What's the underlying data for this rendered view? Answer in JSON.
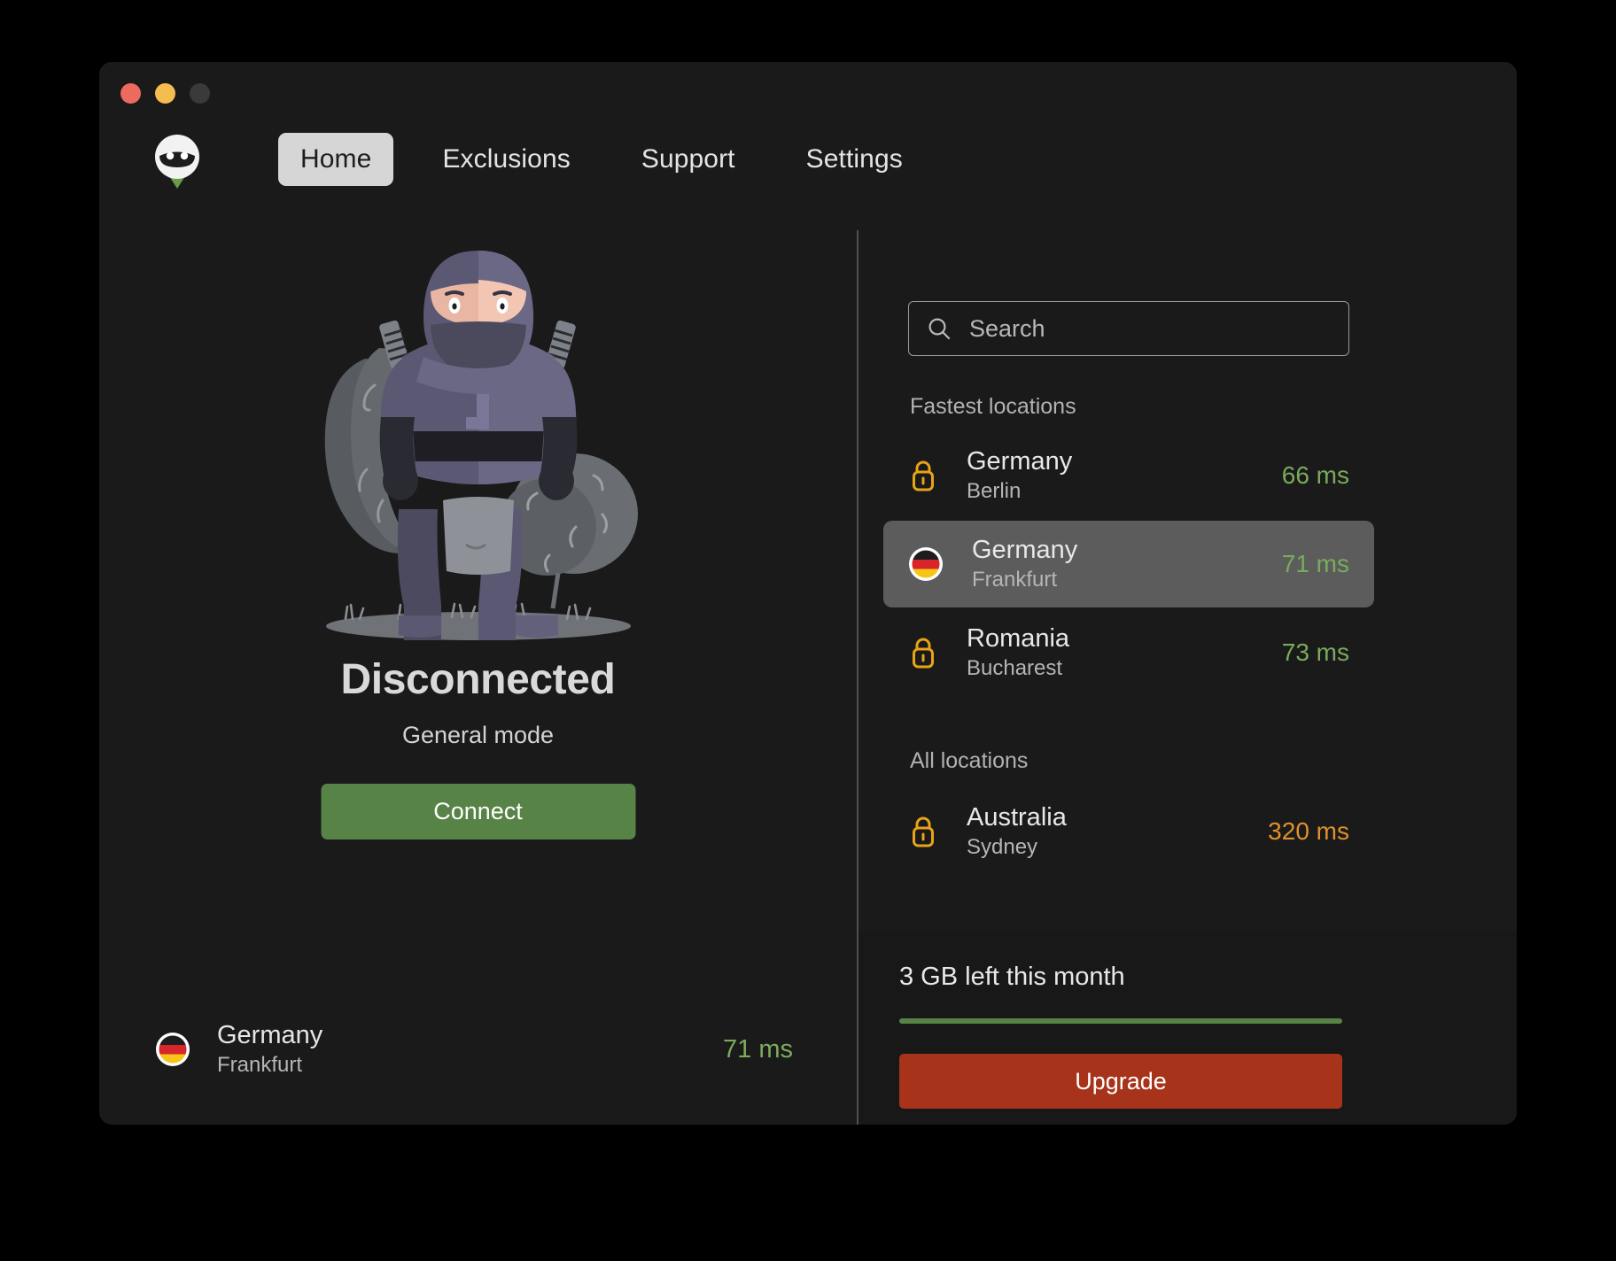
{
  "window": {
    "traffic_lights": [
      {
        "name": "close",
        "color": "#ed6a5e"
      },
      {
        "name": "minimize",
        "color": "#f5bd4f"
      },
      {
        "name": "maximize",
        "color": "#3a3a3a"
      }
    ],
    "background": "#1a1a1a"
  },
  "brand": {
    "logo_icon": "ninja-mascot-icon"
  },
  "nav": {
    "tabs": [
      {
        "label": "Home",
        "active": true
      },
      {
        "label": "Exclusions",
        "active": false
      },
      {
        "label": "Support",
        "active": false
      },
      {
        "label": "Settings",
        "active": false
      }
    ]
  },
  "connection": {
    "illustration_icon": "ninja-illustration",
    "status": "Disconnected",
    "mode": "General mode",
    "connect_label": "Connect",
    "connect_color": "#588346",
    "current_location": {
      "flag_icon": "flag-germany-icon",
      "country": "Germany",
      "city": "Frankfurt",
      "ping": "71 ms",
      "ping_color": "#7aab5b"
    }
  },
  "search": {
    "icon": "search-icon",
    "placeholder": "Search",
    "value": ""
  },
  "locations": {
    "fastest_label": "Fastest locations",
    "all_label": "All locations",
    "fastest": [
      {
        "icon": "lock-icon",
        "country": "Germany",
        "city": "Berlin",
        "ping": "66 ms",
        "ping_state": "good",
        "selected": false
      },
      {
        "icon": "flag-germany-icon",
        "country": "Germany",
        "city": "Frankfurt",
        "ping": "71 ms",
        "ping_state": "good",
        "selected": true
      },
      {
        "icon": "lock-icon",
        "country": "Romania",
        "city": "Bucharest",
        "ping": "73 ms",
        "ping_state": "good",
        "selected": false
      }
    ],
    "all": [
      {
        "icon": "lock-icon",
        "country": "Australia",
        "city": "Sydney",
        "ping": "320 ms",
        "ping_state": "slow",
        "selected": false
      }
    ]
  },
  "usage": {
    "text": "3 GB left this month",
    "progress_percent": 100,
    "progress_color": "#588346",
    "upgrade_label": "Upgrade",
    "upgrade_color": "#a6331a"
  }
}
